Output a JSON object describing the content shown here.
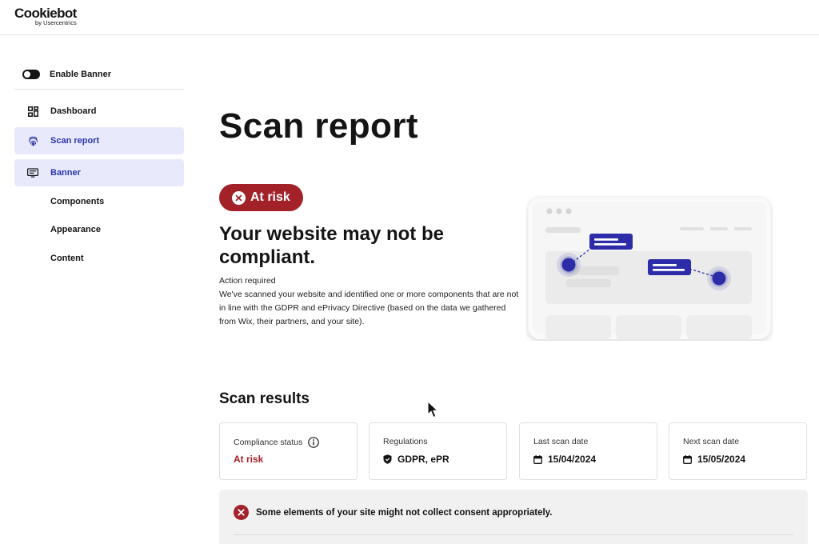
{
  "brand": {
    "name": "Cookiebot",
    "sub": "by Usercentrics"
  },
  "sidebar": {
    "toggle_label": "Enable Banner",
    "items": [
      {
        "label": "Dashboard",
        "icon": "dashboard-icon"
      },
      {
        "label": "Scan report",
        "icon": "fingerprint-icon",
        "active": true
      },
      {
        "label": "Banner",
        "icon": "banner-icon",
        "expanded": true
      }
    ],
    "sub_items": [
      {
        "label": "Components"
      },
      {
        "label": "Appearance"
      },
      {
        "label": "Content"
      }
    ]
  },
  "main": {
    "title": "Scan report",
    "badge": {
      "label": "At risk",
      "color": "#a3222a"
    },
    "headline": "Your website may not be compliant.",
    "action_required": "Action required",
    "description": "We've scanned your website and identified one or more components that are not in line with the GDPR and ePrivacy Directive (based on the data we gathered from Wix, their partners, and your site).",
    "results_title": "Scan results",
    "cards": {
      "compliance": {
        "label": "Compliance status",
        "value": "At risk"
      },
      "regulations": {
        "label": "Regulations",
        "value": "GDPR, ePR"
      },
      "last_scan": {
        "label": "Last scan date",
        "value": "15/04/2024"
      },
      "next_scan": {
        "label": "Next scan date",
        "value": "15/05/2024"
      }
    },
    "alert": {
      "text": "Some elements of your site might not collect consent appropriately."
    }
  },
  "colors": {
    "accent": "#2b35a8",
    "danger": "#a3222a",
    "active_bg": "#e8eafc"
  }
}
